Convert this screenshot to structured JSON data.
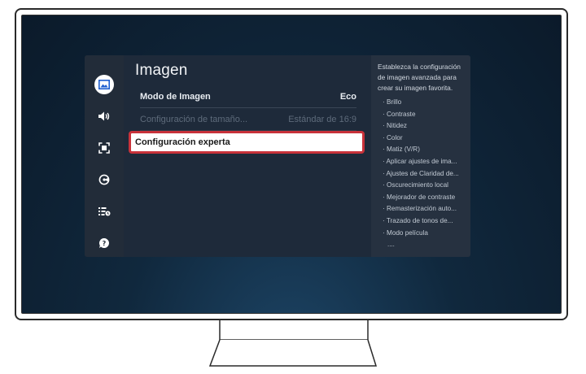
{
  "rail": {
    "icons": [
      {
        "name": "picture-icon",
        "active": true
      },
      {
        "name": "sound-icon",
        "active": false
      },
      {
        "name": "connection-icon",
        "active": false
      },
      {
        "name": "support-icon",
        "active": false
      },
      {
        "name": "general-icon",
        "active": false
      },
      {
        "name": "help-icon",
        "active": false
      }
    ]
  },
  "content": {
    "title": "Imagen",
    "rows": [
      {
        "label": "Modo de Imagen",
        "value": "Eco",
        "state": "normal"
      },
      {
        "label": "Configuración de tamaño...",
        "value": "Estándar de 16:9",
        "state": "disabled"
      }
    ],
    "selected": {
      "label": "Configuración experta"
    }
  },
  "info": {
    "description": "Establezca la configuración de imagen avanzada para crear su imagen favorita.",
    "items": [
      "· Brillo",
      "· Contraste",
      "· Nitidez",
      "· Color",
      "· Matiz (V/R)",
      "· Aplicar ajustes de ima...",
      "· Ajustes de Claridad de...",
      "· Oscurecimiento local",
      "· Mejorador de contraste",
      "· Remasterización auto...",
      "· Trazado de tonos de...",
      "· Modo película"
    ],
    "more": "...."
  },
  "colors": {
    "highlight_border": "#c8323a",
    "panel_bg": "#1e2a3a",
    "screen_bg": "#10283d"
  }
}
